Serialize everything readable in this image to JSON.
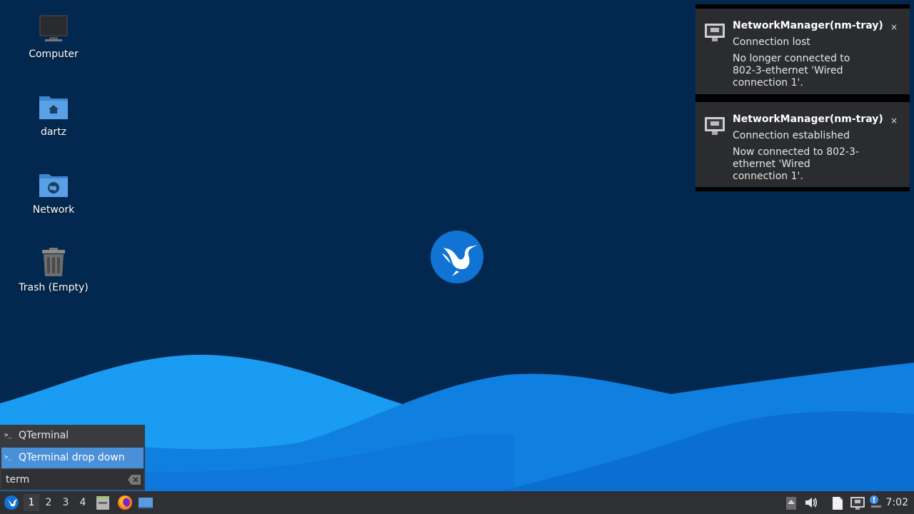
{
  "desktop": {
    "icons": [
      {
        "label": "Computer",
        "icon": "computer-icon"
      },
      {
        "label": "dartz",
        "icon": "home-folder-icon"
      },
      {
        "label": "Network",
        "icon": "network-folder-icon"
      },
      {
        "label": "Trash (Empty)",
        "icon": "trash-icon"
      }
    ],
    "center_logo": "hummingbird-logo-icon",
    "colors": {
      "background": "#03284f",
      "wave_light": "#1a9cf2",
      "wave_mid": "#0f7fe0",
      "wave_dark": "#0a62c4"
    }
  },
  "notifications": [
    {
      "app": "NetworkManager(nm-tray)",
      "summary": "Connection lost",
      "body": "No longer connected to 802-3-ethernet 'Wired connection 1'.",
      "icon": "ethernet-icon",
      "close_label": "×"
    },
    {
      "app": "NetworkManager(nm-tray)",
      "summary": "Connection established",
      "body": "Now connected to 802-3-ethernet 'Wired connection 1'.",
      "icon": "ethernet-icon",
      "close_label": "×"
    }
  ],
  "runner": {
    "items": [
      {
        "label": "QTerminal",
        "icon_text": ">_",
        "selected": false
      },
      {
        "label": "QTerminal drop down",
        "icon_text": ">_",
        "selected": true
      }
    ],
    "input_value": "term",
    "selection_color": "#4a90d9"
  },
  "taskbar": {
    "workspaces": [
      "1",
      "2",
      "3",
      "4"
    ],
    "active_workspace": "1",
    "quicklaunch": [
      "file-manager-icon",
      "firefox-icon",
      "show-desktop-icon"
    ],
    "tray": [
      "up-arrow-icon",
      "volume-icon",
      "clipboard-icon",
      "network-tray-icon",
      "update-notifier-icon"
    ],
    "clock": "7:02"
  }
}
